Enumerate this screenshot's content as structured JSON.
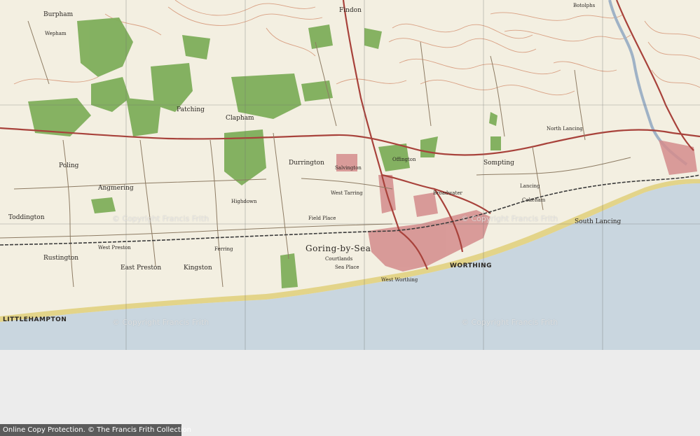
{
  "map": {
    "title_places": [
      {
        "name": "Burpham"
      },
      {
        "name": "Wepham"
      },
      {
        "name": "Angmering"
      },
      {
        "name": "Patching"
      },
      {
        "name": "Clapham"
      },
      {
        "name": "Findon"
      },
      {
        "name": "Sompting"
      },
      {
        "name": "Cokeham"
      },
      {
        "name": "Poling"
      },
      {
        "name": "Toddington"
      },
      {
        "name": "Rustington"
      },
      {
        "name": "East Preston"
      },
      {
        "name": "Kingston"
      },
      {
        "name": "Goring-by-Sea"
      },
      {
        "name": "Durrington"
      },
      {
        "name": "West Tarring"
      },
      {
        "name": "Broadwater"
      },
      {
        "name": "Offington"
      },
      {
        "name": "WORTHING"
      },
      {
        "name": "LITTLEHAMPTON"
      },
      {
        "name": "South Lancing"
      },
      {
        "name": "North Lancing"
      },
      {
        "name": "Field Place"
      },
      {
        "name": "Salvington"
      },
      {
        "name": "Highdown"
      },
      {
        "name": "Ferring"
      },
      {
        "name": "West Preston"
      },
      {
        "name": "Courtlands"
      },
      {
        "name": "Sea Place"
      },
      {
        "name": "West Worthing"
      },
      {
        "name": "Botolphs"
      },
      {
        "name": "Lancing"
      }
    ],
    "watermarks": [
      {
        "text": "© Copyright Francis Frith"
      },
      {
        "text": "© Copyright Francis Frith"
      },
      {
        "text": "© Copyright Francis Frith"
      },
      {
        "text": "© Copyright Francis Frith"
      }
    ],
    "colors": {
      "land": "#f3efe1",
      "sea": "#c9d6df",
      "woodland": "#7fae5b",
      "contours": "#d08563",
      "roads_main": "#a8423b",
      "roads_minor": "#8d7b63",
      "beach": "#e3d489",
      "built_up": "#d48c8c",
      "grid": "#6d6d6d",
      "river": "#9fb2c6"
    }
  },
  "footer": {
    "online_copy": "Online Copy Protection.",
    "copyright": "© The Francis Frith Collection"
  }
}
